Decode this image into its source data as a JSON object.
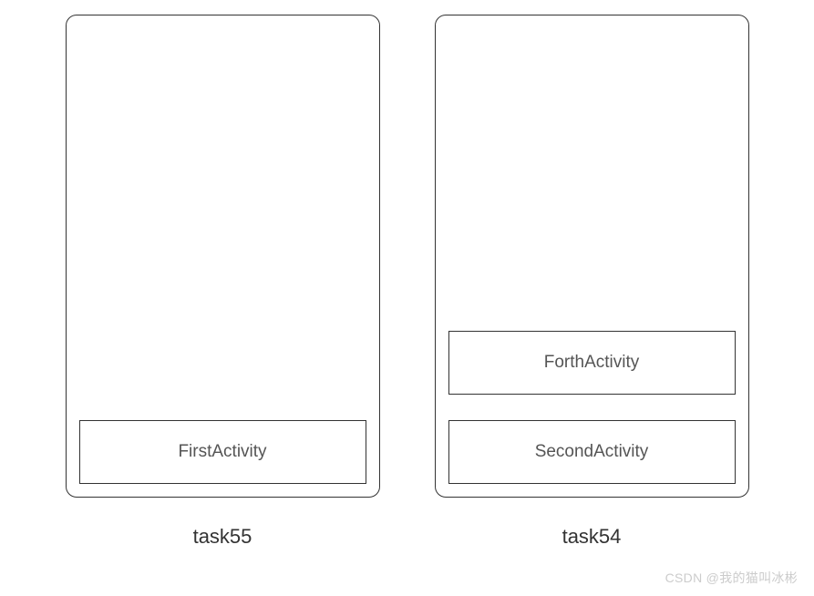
{
  "diagram": {
    "tasks": [
      {
        "label": "task55",
        "activities": [
          {
            "name": "FirstActivity"
          }
        ]
      },
      {
        "label": "task54",
        "activities": [
          {
            "name": "ForthActivity"
          },
          {
            "name": "SecondActivity"
          }
        ]
      }
    ]
  },
  "watermark": "CSDN @我的猫叫冰彬"
}
